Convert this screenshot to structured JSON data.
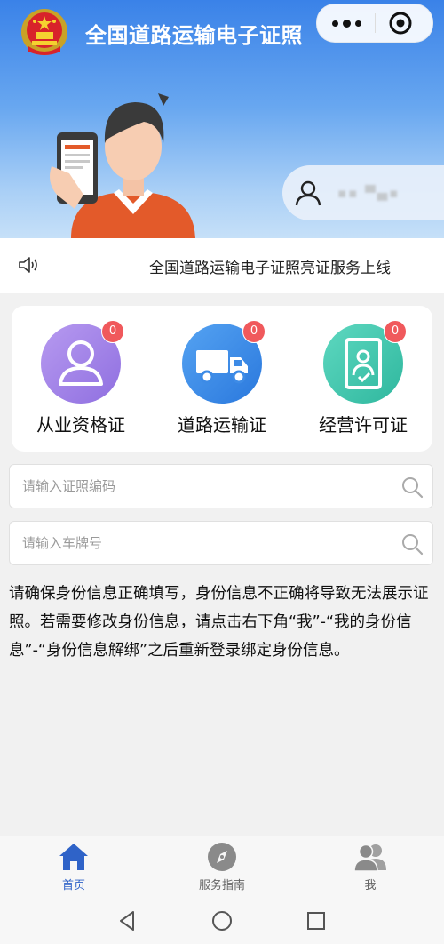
{
  "header": {
    "title": "全国道路运输电子证照",
    "emblem_icon": "national-emblem-icon",
    "more_icon": "more-dots-icon",
    "close_icon": "miniprogram-close-icon"
  },
  "user": {
    "name": "▪▪ ▀▄▪",
    "icon": "user-icon"
  },
  "notice": {
    "icon": "speaker-icon",
    "text": "全国道路运输电子证照亮证服务上线"
  },
  "certificates": [
    {
      "label": "从业资格证",
      "count": "0",
      "icon": "person-certificate-icon",
      "color": "#9a7de8"
    },
    {
      "label": "道路运输证",
      "count": "0",
      "icon": "truck-icon",
      "color": "#3d8be6"
    },
    {
      "label": "经营许可证",
      "count": "0",
      "icon": "license-document-icon",
      "color": "#3cc6ae"
    }
  ],
  "search": [
    {
      "placeholder": "请输入证照编码",
      "value": "",
      "icon": "search-icon"
    },
    {
      "placeholder": "请输入车牌号",
      "value": "",
      "icon": "search-icon"
    }
  ],
  "help_text": "请确保身份信息正确填写，身份信息不正确将导致无法展示证照。若需要修改身份信息，请点击右下角“我”-“我的身份信息”-“身份信息解绑”之后重新登录绑定身份信息。",
  "tabs": [
    {
      "label": "首页",
      "icon": "home-icon",
      "active": true
    },
    {
      "label": "服务指南",
      "icon": "compass-icon",
      "active": false
    },
    {
      "label": "我",
      "icon": "users-icon",
      "active": false
    }
  ],
  "system_nav": {
    "back_icon": "back-triangle-icon",
    "home_icon": "home-circle-icon",
    "recents_icon": "recents-square-icon"
  },
  "colors": {
    "accent": "#2f63c8",
    "banner_top": "#3a82e8",
    "badge": "#f0595c"
  }
}
